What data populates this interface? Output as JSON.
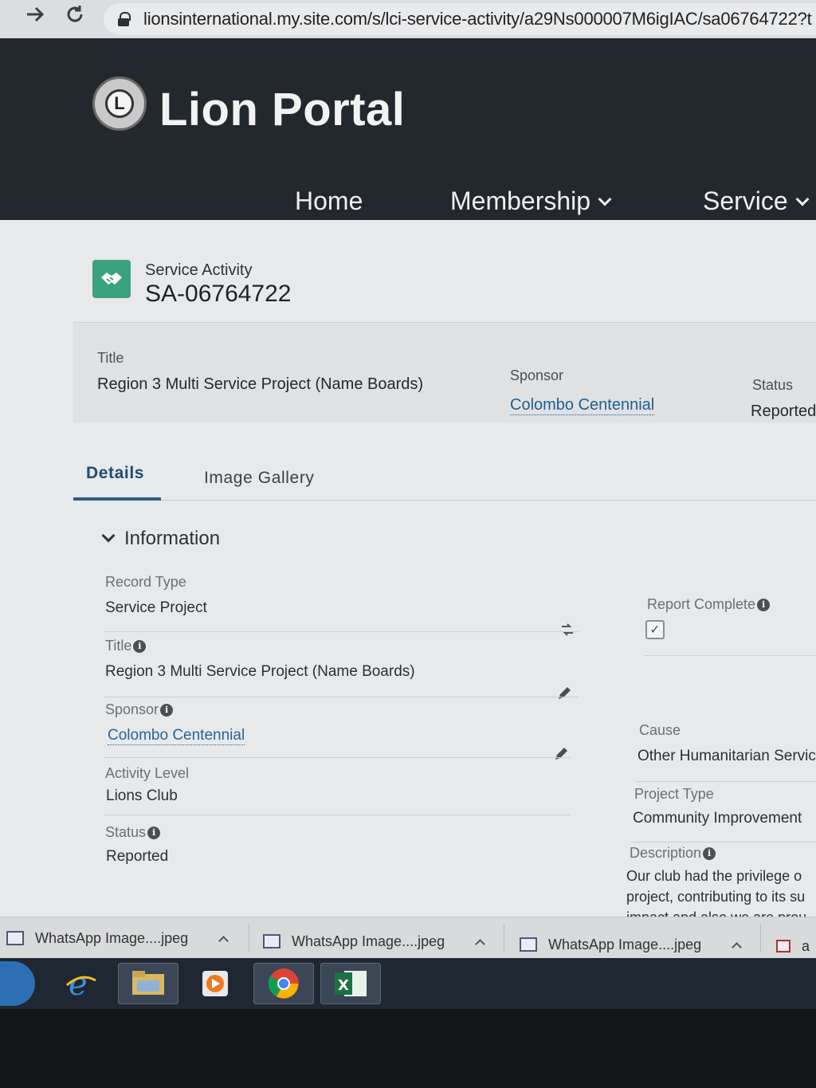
{
  "browser": {
    "url": "lionsinternational.my.site.com/s/lci-service-activity/a29Ns000007M6igIAC/sa06764722?t"
  },
  "header": {
    "brand": "Lion Portal",
    "logo_letter": "L",
    "nav": [
      {
        "label": "Home"
      },
      {
        "label": "Membership"
      },
      {
        "label": "Service"
      }
    ]
  },
  "record": {
    "type_label": "Service Activity",
    "id": "SA-06764722"
  },
  "highlights": {
    "title_label": "Title",
    "title_value": "Region 3 Multi Service Project (Name Boards)",
    "sponsor_label": "Sponsor",
    "sponsor_value": "Colombo Centennial",
    "status_label": "Status",
    "status_value": "Reported"
  },
  "tabs": [
    {
      "label": "Details",
      "active": true
    },
    {
      "label": "Image Gallery",
      "active": false
    }
  ],
  "section": {
    "title": "Information"
  },
  "fields": {
    "record_type_label": "Record Type",
    "record_type_value": "Service Project",
    "title_label": "Title",
    "title_value": "Region 3 Multi Service Project (Name Boards)",
    "sponsor_label": "Sponsor",
    "sponsor_value": "Colombo Centennial",
    "activity_level_label": "Activity Level",
    "activity_level_value": "Lions Club",
    "status_label": "Status",
    "status_value": "Reported",
    "report_complete_label": "Report Complete",
    "report_complete_checked": true,
    "cause_label": "Cause",
    "cause_value": "Other Humanitarian Servic",
    "project_type_label": "Project Type",
    "project_type_value": "Community Improvement",
    "description_label": "Description",
    "description_lines": [
      "Our club had the privilege o",
      "project, contributing to its su",
      "impact and also we are prou"
    ]
  },
  "downloads": [
    {
      "name": "WhatsApp Image....jpeg"
    },
    {
      "name": "WhatsApp Image....jpeg"
    },
    {
      "name": "WhatsApp Image....jpeg"
    }
  ],
  "downloads_overflow": "a",
  "colors": {
    "header_bg": "#23272e",
    "accent_green": "#3aa27f",
    "link_blue": "#2a6496",
    "tab_active": "#1e4c73"
  }
}
